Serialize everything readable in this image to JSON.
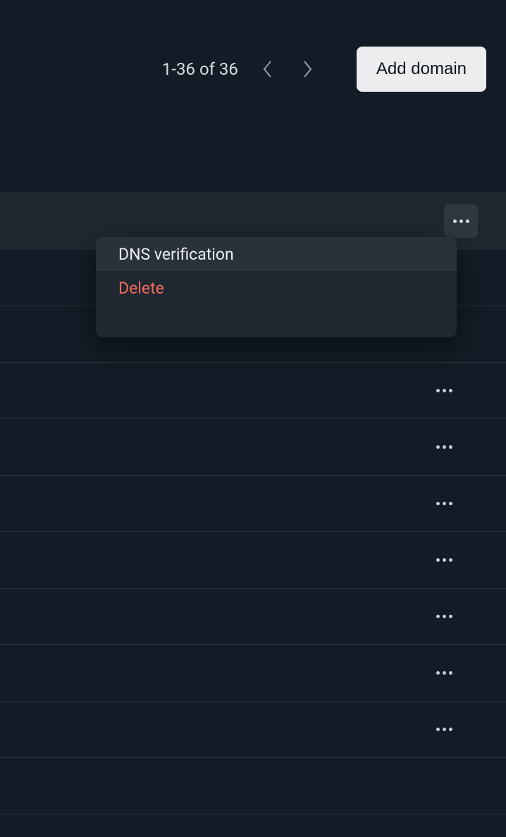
{
  "pagination": {
    "range_text": "1-36 of 36"
  },
  "actions": {
    "add_domain_label": "Add domain"
  },
  "context_menu": {
    "dns_verification": "DNS verification",
    "delete": "Delete"
  },
  "colors": {
    "danger": "#f26b5b"
  }
}
